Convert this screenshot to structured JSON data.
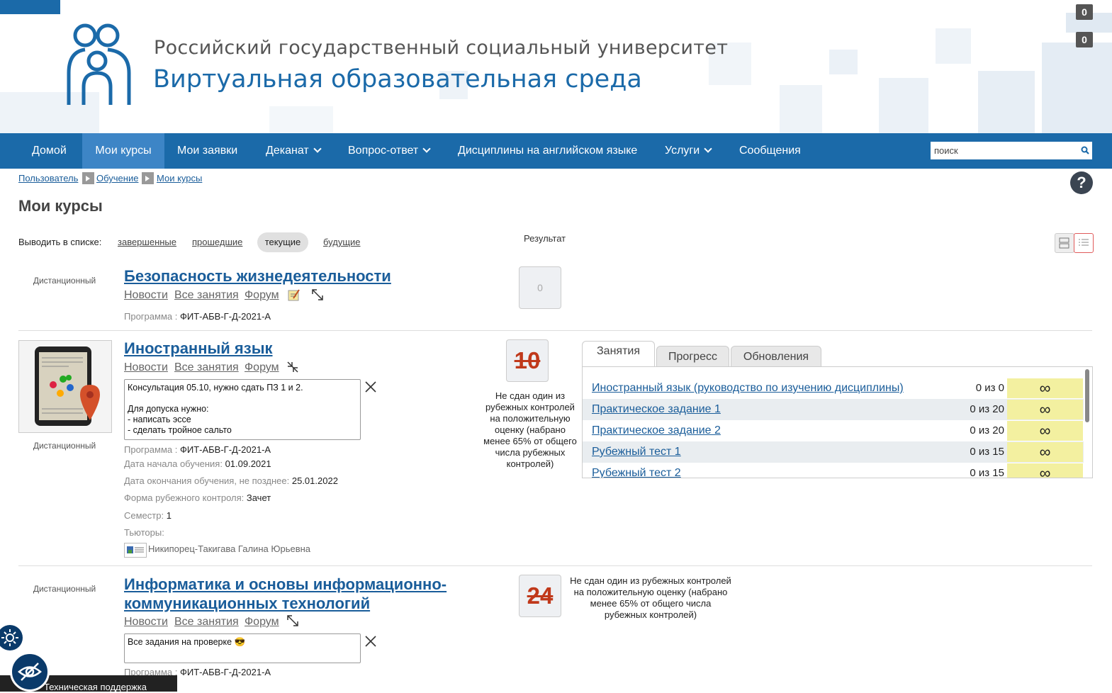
{
  "header": {
    "university": "Российский государственный социальный университет",
    "environment": "Виртуальная образовательная среда",
    "counter_top": "0",
    "counter_bottom": "0"
  },
  "nav": {
    "items": [
      {
        "label": "Домой"
      },
      {
        "label": "Мои курсы"
      },
      {
        "label": "Мои заявки"
      },
      {
        "label": "Деканат"
      },
      {
        "label": "Вопрос-ответ"
      },
      {
        "label": "Дисциплины на английском языке"
      },
      {
        "label": "Услуги"
      },
      {
        "label": "Сообщения"
      }
    ],
    "active": "Мои курсы",
    "search_placeholder": "поиск"
  },
  "breadcrumb": [
    "Пользователь",
    "Обучение",
    "Мои курсы"
  ],
  "page_title": "Мои курсы",
  "filter": {
    "label": "Выводить в списке:",
    "options": [
      "завершенные",
      "прошедшие",
      "текущие",
      "будущие"
    ],
    "selected": "текущие"
  },
  "result_label": "Результат",
  "courses": [
    {
      "mode": "Дистанционный",
      "title": "Безопасность жизнедеятельности",
      "links": [
        "Новости",
        "Все занятия",
        "Форум"
      ],
      "program_label": "Программа",
      "program": "ФИТ-АБВ-Г-Д-2021-А",
      "score": "0"
    },
    {
      "mode": "Дистанционный",
      "title": "Иностранный язык",
      "links": [
        "Новости",
        "Все занятия",
        "Форум"
      ],
      "note": "Консультация 05.10, нужно сдать ПЗ 1 и 2.\n\nДля допуска нужно:\n - написать эссе\n - сделать тройное сальто",
      "program_label": "Программа",
      "program": "ФИТ-АБВ-Г-Д-2021-А",
      "start_label": "Дата начала обучения:",
      "start": "01.09.2021",
      "end_label": "Дата окончания обучения, не позднее:",
      "end": "25.01.2022",
      "control_label": "Форма рубежного контроля",
      "control": "Зачет",
      "semester_label": "Семестр",
      "semester": "1",
      "tutors_label": "Тьюторы:",
      "tutor": "Никипорец-Такигава Галина Юрьевна",
      "score": "10",
      "fail_note": "Не сдан один из рубежных контролей на положительную оценку (набрано менее 65% от общего числа рубежных контролей)",
      "tabs": [
        "Занятия",
        "Прогресс",
        "Обновления"
      ],
      "active_tab": "Занятия",
      "lessons": [
        {
          "name": "Иностранный язык (руководство по изучению дисциплины)",
          "score": "0 из 0",
          "limit": "∞"
        },
        {
          "name": "Практическое задание 1",
          "score": "0 из 20",
          "limit": "∞"
        },
        {
          "name": "Практическое задание 2",
          "score": "0 из 20",
          "limit": "∞"
        },
        {
          "name": "Рубежный тест 1",
          "score": "0 из 15",
          "limit": "∞"
        },
        {
          "name": "Рубежный тест 2",
          "score": "0 из 15",
          "limit": "∞"
        }
      ]
    },
    {
      "mode": "Дистанционный",
      "title_line1": "Информатика и основы информационно-",
      "title_line2": "коммуникационных технологий",
      "links": [
        "Новости",
        "Все занятия",
        "Форум"
      ],
      "note": "Все задания на проверке 😎",
      "program_label": "Программа",
      "program": "ФИТ-АБВ-Г-Д-2021-А",
      "score": "24",
      "fail_note": "Не сдан один из рубежных контролей на положительную оценку (набрано менее 65% от общего числа рубежных контролей)"
    }
  ],
  "support_label": "Техническая поддержка"
}
